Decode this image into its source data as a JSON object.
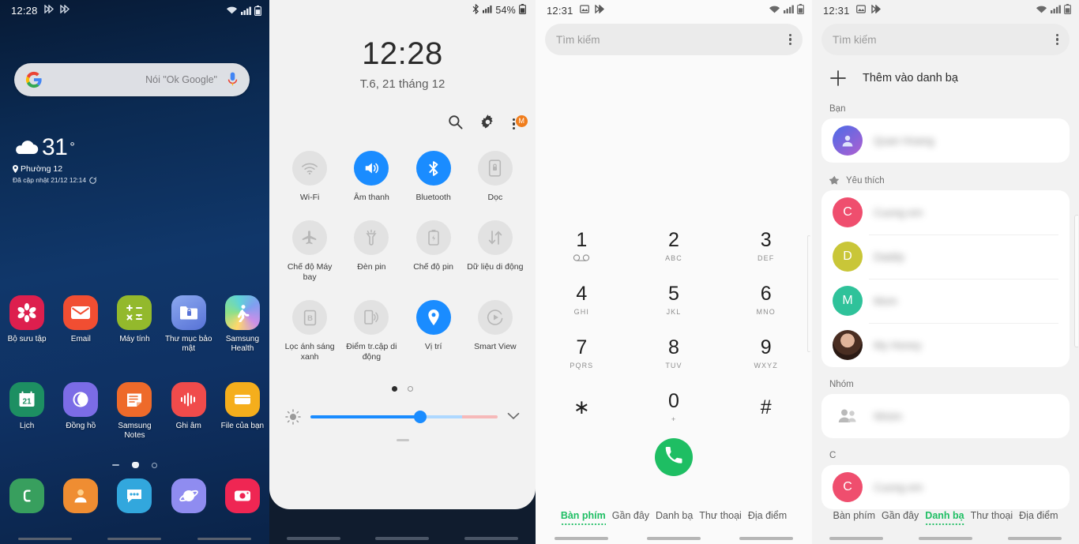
{
  "home": {
    "status": {
      "time": "12:28",
      "left_icons": [
        "play-icon",
        "play-icon"
      ],
      "right_icons": [
        "wifi-icon",
        "signal-icon",
        "battery-icon"
      ]
    },
    "search": {
      "placeholder": "Nói \"Ok Google\"",
      "logo": "google-logo",
      "mic": "microphone-icon"
    },
    "weather": {
      "icon": "cloud-icon",
      "temperature": "31",
      "degree": "°",
      "location": "Phường 12",
      "updated": "Đã cập nhật 21/12 12:14",
      "refresh_icon": "refresh-icon"
    },
    "apps_row1": [
      {
        "label": "Bộ sưu tập",
        "icon": "gallery-icon",
        "color": "#dd1f4e"
      },
      {
        "label": "Email",
        "icon": "email-icon",
        "color": "#f14e32"
      },
      {
        "label": "Máy tính",
        "icon": "calculator-icon",
        "color": "#93b92c"
      },
      {
        "label": "Thư mục bảo mật",
        "icon": "secure-folder-icon",
        "color": "#6b8ee8"
      },
      {
        "label": "Samsung Health",
        "icon": "health-icon",
        "color": "#7fd4d8"
      }
    ],
    "apps_row2": [
      {
        "label": "Lịch",
        "icon": "calendar-icon",
        "color": "#1d8f62",
        "badge": "21"
      },
      {
        "label": "Đồng hồ",
        "icon": "clock-icon",
        "color": "#7b6ce6"
      },
      {
        "label": "Samsung Notes",
        "icon": "notes-icon",
        "color": "#ee6a2a"
      },
      {
        "label": "Ghi âm",
        "icon": "voice-recorder-icon",
        "color": "#f04b4b"
      },
      {
        "label": "File của bạn",
        "icon": "my-files-icon",
        "color": "#f5ae1c"
      }
    ],
    "page_dots": [
      "list-icon",
      "home-icon",
      "circle-icon"
    ],
    "dock": [
      {
        "label": "Điện thoại",
        "icon": "phone-icon",
        "color": "#389f5e"
      },
      {
        "label": "Danh bạ",
        "icon": "contacts-icon",
        "color": "#ef8d32"
      },
      {
        "label": "Tin nhắn",
        "icon": "messages-icon",
        "color": "#32a7dd"
      },
      {
        "label": "Internet",
        "icon": "internet-icon",
        "color": "#8f8cf0"
      },
      {
        "label": "Máy ảnh",
        "icon": "camera-icon",
        "color": "#ef2653"
      }
    ]
  },
  "quick_panel": {
    "status": {
      "icons": [
        "bluetooth-icon",
        "signal-icon"
      ],
      "battery_percent": "54%",
      "battery_icon": "battery-icon"
    },
    "clock": {
      "time": "12:28",
      "date": "T.6, 21 tháng 12"
    },
    "actions": [
      {
        "name": "search-icon"
      },
      {
        "name": "settings-gear-icon"
      },
      {
        "name": "more-options-icon",
        "badge": "M"
      }
    ],
    "tiles": [
      {
        "label": "Wi-Fi",
        "icon": "wifi-icon",
        "on": false
      },
      {
        "label": "Âm thanh",
        "icon": "sound-icon",
        "on": true
      },
      {
        "label": "Bluetooth",
        "icon": "bluetooth-icon",
        "on": true
      },
      {
        "label": "Dọc",
        "icon": "screen-rotation-lock-icon",
        "on": false
      },
      {
        "label": "Chế độ Máy bay",
        "icon": "airplane-icon",
        "on": false
      },
      {
        "label": "Đèn pin",
        "icon": "flashlight-icon",
        "on": false
      },
      {
        "label": "Chế độ pin",
        "icon": "power-saving-icon",
        "on": false
      },
      {
        "label": "Dữ liệu di động",
        "icon": "mobile-data-icon",
        "on": false
      },
      {
        "label": "Lọc ánh sáng xanh",
        "icon": "blue-light-filter-icon",
        "on": false
      },
      {
        "label": "Điểm tr.cập di động",
        "icon": "mobile-hotspot-icon",
        "on": false
      },
      {
        "label": "Vị trí",
        "icon": "location-icon",
        "on": true
      },
      {
        "label": "Smart View",
        "icon": "smart-view-icon",
        "on": false
      }
    ],
    "page_dots": [
      true,
      false
    ],
    "brightness": {
      "icon": "brightness-icon",
      "value_percent": 58,
      "expand_icon": "chevron-down-icon"
    }
  },
  "dialer": {
    "status": {
      "time": "12:31",
      "left_icons": [
        "image-icon",
        "play-icon"
      ],
      "right_icons": [
        "wifi-icon",
        "signal-icon",
        "battery-icon"
      ]
    },
    "search": {
      "placeholder": "Tìm kiếm",
      "menu_icon": "more-options-icon"
    },
    "keys": [
      {
        "num": "1",
        "sub": "voicemail-icon"
      },
      {
        "num": "2",
        "sub": "ABC"
      },
      {
        "num": "3",
        "sub": "DEF"
      },
      {
        "num": "4",
        "sub": "GHI"
      },
      {
        "num": "5",
        "sub": "JKL"
      },
      {
        "num": "6",
        "sub": "MNO"
      },
      {
        "num": "7",
        "sub": "PQRS"
      },
      {
        "num": "8",
        "sub": "TUV"
      },
      {
        "num": "9",
        "sub": "WXYZ"
      },
      {
        "num": "∗",
        "sub": ""
      },
      {
        "num": "0",
        "sub": "+"
      },
      {
        "num": "#",
        "sub": ""
      }
    ],
    "call_button": {
      "icon": "call-icon",
      "color": "#1ebe63"
    },
    "tabs": [
      {
        "label": "Bàn phím",
        "active": true
      },
      {
        "label": "Gần đây",
        "active": false
      },
      {
        "label": "Danh bạ",
        "active": false
      },
      {
        "label": "Thư thoại",
        "active": false
      },
      {
        "label": "Địa điểm",
        "active": false
      }
    ]
  },
  "contacts": {
    "status": {
      "time": "12:31",
      "left_icons": [
        "image-icon",
        "play-icon"
      ],
      "right_icons": [
        "wifi-icon",
        "signal-icon",
        "battery-icon"
      ]
    },
    "search": {
      "placeholder": "Tìm kiếm",
      "menu_icon": "more-options-icon"
    },
    "add": {
      "label": "Thêm vào danh bạ",
      "icon": "plus-icon"
    },
    "sections": [
      {
        "title": "Bạn",
        "icon": "",
        "rows": [
          {
            "name": "Quan Hoang",
            "avatar_type": "photo-gradient",
            "avatar_color": "#7b5fe0",
            "initial": ""
          }
        ]
      },
      {
        "title": "Yêu thích",
        "icon": "star-icon",
        "rows": [
          {
            "name": "Cuong em",
            "avatar_type": "initial",
            "avatar_color": "#ef4e6e",
            "initial": "C"
          },
          {
            "name": "Daddy",
            "avatar_type": "initial",
            "avatar_color": "#c9c638",
            "initial": "D"
          },
          {
            "name": "Mom",
            "avatar_type": "initial",
            "avatar_color": "#2fc29a",
            "initial": "M"
          },
          {
            "name": "My Honey",
            "avatar_type": "photo",
            "avatar_color": "#6b4a3a",
            "initial": ""
          }
        ]
      },
      {
        "title": "Nhóm",
        "icon": "",
        "rows": [
          {
            "name": "Nhóm",
            "avatar_type": "group",
            "avatar_color": "#bdbdbd",
            "initial": ""
          }
        ]
      },
      {
        "title": "C",
        "icon": "",
        "rows": [
          {
            "name": "Cuong em",
            "avatar_type": "initial",
            "avatar_color": "#ef4e6e",
            "initial": "C"
          }
        ]
      }
    ],
    "tabs": [
      {
        "label": "Bàn phím",
        "active": false
      },
      {
        "label": "Gần đây",
        "active": false
      },
      {
        "label": "Danh bạ",
        "active": true
      },
      {
        "label": "Thư thoại",
        "active": false
      },
      {
        "label": "Địa điểm",
        "active": false
      }
    ]
  }
}
